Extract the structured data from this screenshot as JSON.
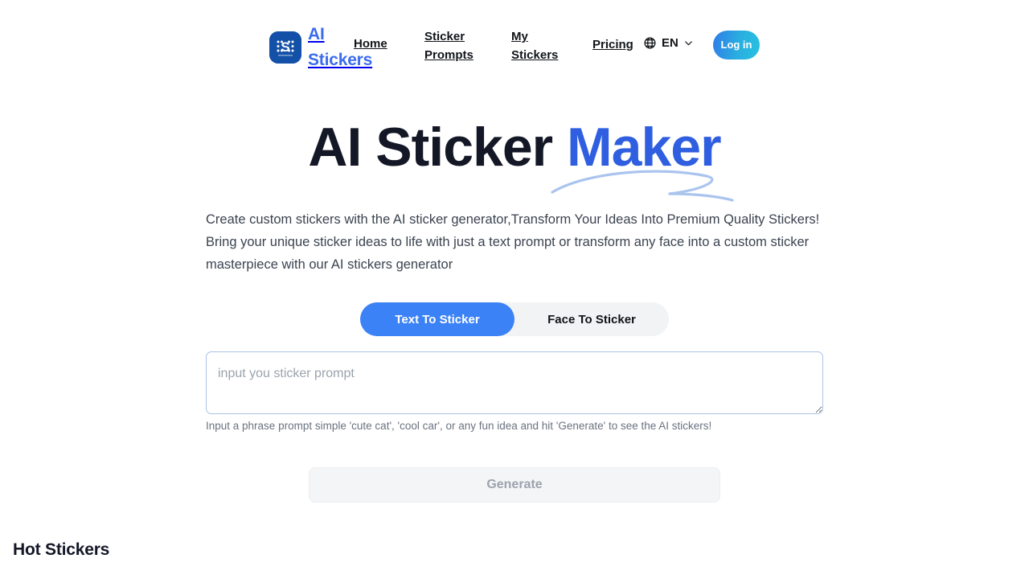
{
  "header": {
    "logo_icon": "sticker-app-logo-icon",
    "brand_name": "AI Stickers",
    "nav": {
      "home": "Home",
      "sticker_prompts": "Sticker Prompts",
      "my_stickers": "My Stickers",
      "pricing": "Pricing"
    },
    "language": {
      "icon": "globe-icon",
      "label": "EN",
      "chevron": "chevron-down-icon"
    },
    "login_label": "Log in"
  },
  "hero": {
    "title_main": "AI Sticker ",
    "title_accent": "Maker",
    "description": "Create custom stickers with the AI sticker generator,Transform Your Ideas Into Premium Quality Stickers! Bring your unique sticker ideas to life with just a text prompt or transform any face into a custom sticker masterpiece with our AI stickers generator"
  },
  "tabs": {
    "text_to_sticker": "Text To Sticker",
    "face_to_sticker": "Face To Sticker",
    "active": "Text To Sticker"
  },
  "prompt": {
    "value": "",
    "placeholder": "input you sticker prompt",
    "hint": "Input a phrase prompt simple 'cute cat', 'cool car', or any fun idea and hit 'Generate' to see the AI stickers!"
  },
  "generate": {
    "label": "Generate"
  },
  "hot_stickers": {
    "title": "Hot Stickers"
  },
  "colors": {
    "accent_blue": "#3b82f6",
    "title_accent": "#2f5fe0",
    "brand_blue": "#3a6ced",
    "logo_bg": "#1351a8",
    "dark_text": "#141726",
    "muted_text": "#6b7280",
    "tab_track": "#f2f3f5",
    "disabled_bg": "#f4f5f7",
    "input_border": "#a9c3e4"
  }
}
